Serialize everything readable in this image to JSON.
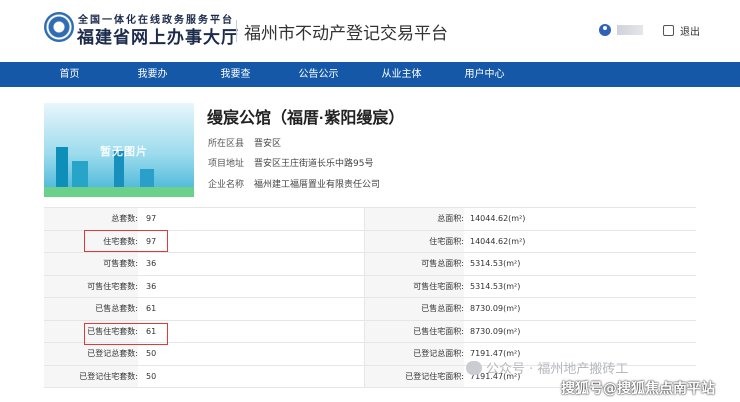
{
  "header": {
    "logo_top": "全国一体化在线政务服务平台",
    "logo_main": "福建省网上办事大厅",
    "platform_title": "福州市不动产登记交易平台",
    "logout_label": "退出"
  },
  "nav": {
    "items": [
      "首页",
      "我要办",
      "我要查",
      "公告公示",
      "从业主体",
      "用户中心"
    ]
  },
  "property": {
    "banner_label": "暂无图片",
    "name": "缦宸公馆（福厝·紫阳缦宸）",
    "district_label": "所在区县",
    "district": "晋安区",
    "address_label": "项目地址",
    "address": "晋安区王庄街道长乐中路95号",
    "company_label": "企业名称",
    "company": "福州建工福厝置业有限责任公司"
  },
  "table": {
    "rows": [
      {
        "label1": "总套数:",
        "value1": "97",
        "label2": "总面积:",
        "value2": "14044.62(m²)"
      },
      {
        "label1": "住宅套数:",
        "value1": "97",
        "label2": "住宅面积:",
        "value2": "14044.62(m²)"
      },
      {
        "label1": "可售套数:",
        "value1": "36",
        "label2": "可售总面积:",
        "value2": "5314.53(m²)"
      },
      {
        "label1": "可售住宅套数:",
        "value1": "36",
        "label2": "可售住宅面积:",
        "value2": "5314.53(m²)"
      },
      {
        "label1": "已售总套数:",
        "value1": "61",
        "label2": "已售总面积:",
        "value2": "8730.09(m²)"
      },
      {
        "label1": "已售住宅套数:",
        "value1": "61",
        "label2": "已售住宅面积:",
        "value2": "8730.09(m²)"
      },
      {
        "label1": "已登记总套数:",
        "value1": "50",
        "label2": "已登记总面积:",
        "value2": "7191.47(m²)"
      },
      {
        "label1": "已登记住宅套数:",
        "value1": "50",
        "label2": "已登记住宅面积:",
        "value2": "7191.47(m²)"
      }
    ]
  },
  "watermark": {
    "line1": "公众号 · 福州地产搬砖工",
    "line2": "搜狐号@搜狐焦点南平站"
  },
  "colors": {
    "nav_bg": "#1658a8",
    "highlight": "#e03a3a"
  }
}
